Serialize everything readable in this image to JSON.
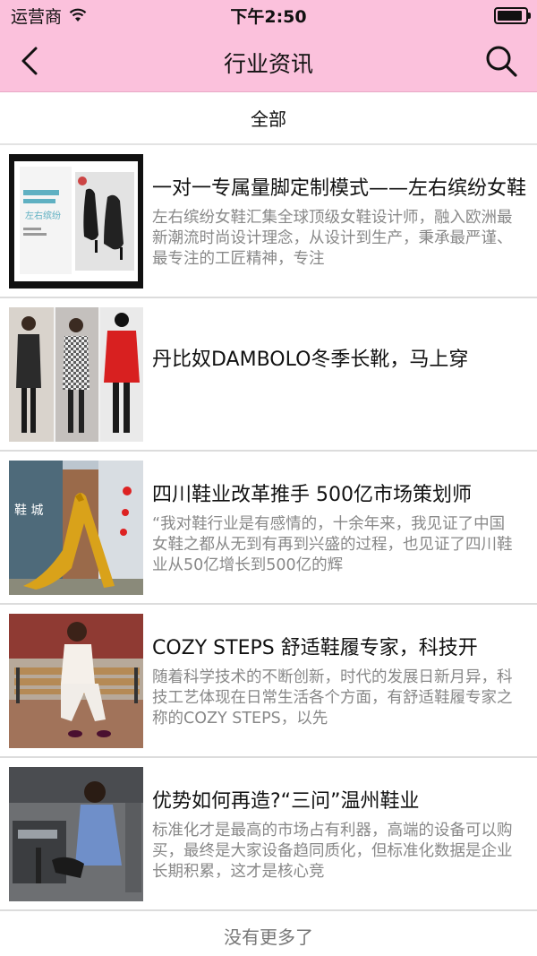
{
  "status_bar": {
    "carrier": "运营商",
    "time": "下午2:50",
    "wifi_icon": "wifi-icon",
    "battery_icon": "battery-icon",
    "battery_level": 0.95
  },
  "nav": {
    "title": "行业资讯",
    "back_icon": "chevron-left-icon",
    "search_icon": "search-icon"
  },
  "tabs": {
    "selected": "全部"
  },
  "articles": [
    {
      "title": "一对一专属量脚定制模式——左右缤纷女鞋",
      "desc": "左右缤纷女鞋汇集全球顶级女鞋设计师，融入欧洲最新潮流时尚设计理念，从设计到生产，秉承最严谨、最专注的工匠精神，专注"
    },
    {
      "title": "丹比奴DAMBOLO冬季长靴，马上穿",
      "desc": ""
    },
    {
      "title": "四川鞋业改革推手 500亿市场策划师",
      "desc": "“我对鞋行业是有感情的，十余年来，我见证了中国女鞋之都从无到有再到兴盛的过程，也见证了四川鞋业从50亿增长到500亿的辉"
    },
    {
      "title": "COZY STEPS 舒适鞋履专家，科技开",
      "desc": "随着科学技术的不断创新，时代的发展日新月异，科技工艺体现在日常生活各个方面，有舒适鞋履专家之称的COZY STEPS，以先"
    },
    {
      "title": "优势如何再造?“三问”温州鞋业",
      "desc": "标准化才是最高的市场占有利器，高端的设备可以购买，最终是大家设备趋同质化，但标准化数据是企业长期积累，这才是核心竞"
    }
  ],
  "thumb_texts": {
    "item1_line1": "左右缤纷",
    "item3_sign": "鞋 城"
  },
  "footer": {
    "text": "没有更多了"
  }
}
